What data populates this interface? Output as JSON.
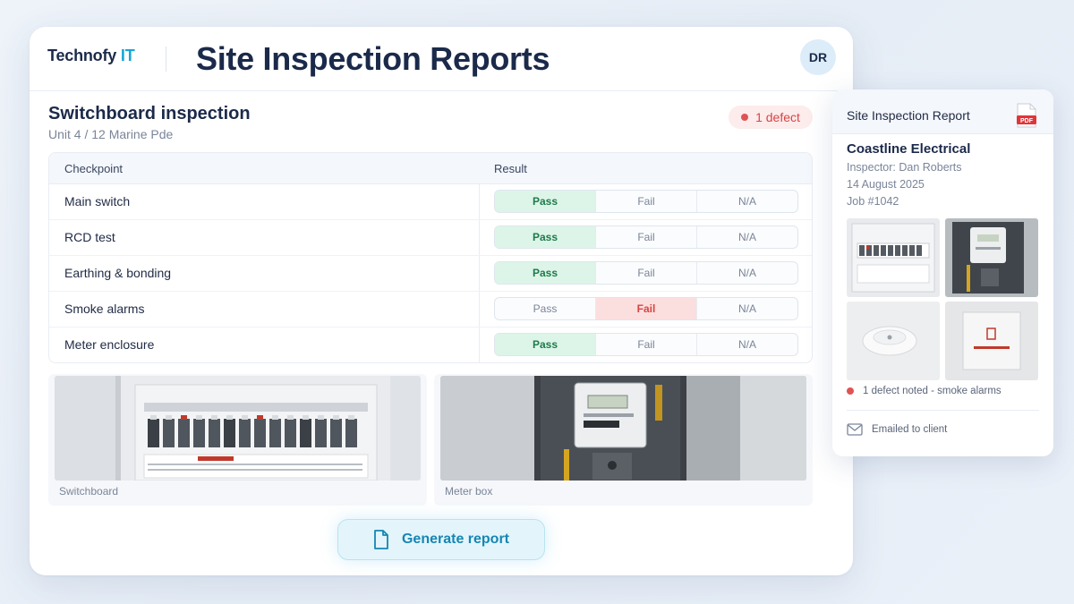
{
  "header": {
    "brand_name": "Technofy",
    "brand_accent": "IT",
    "title": "Site Inspection Reports",
    "avatar_initials": "DR"
  },
  "inspection": {
    "title": "Switchboard inspection",
    "address": "Unit 4 / 12 Marine Pde",
    "defect_badge": "1 defect",
    "columns": [
      "Checkpoint",
      "Result"
    ],
    "options": [
      "Pass",
      "Fail",
      "N/A"
    ],
    "rows": [
      {
        "checkpoint": "Main switch",
        "result": "Pass"
      },
      {
        "checkpoint": "RCD test",
        "result": "Pass"
      },
      {
        "checkpoint": "Earthing & bonding",
        "result": "Pass"
      },
      {
        "checkpoint": "Smoke alarms",
        "result": "Fail"
      },
      {
        "checkpoint": "Meter enclosure",
        "result": "Pass"
      }
    ]
  },
  "photos": [
    {
      "caption": "Switchboard"
    },
    {
      "caption": "Meter box"
    }
  ],
  "actions": {
    "generate_label": "Generate report",
    "icon": "document-icon"
  },
  "report": {
    "title": "Site Inspection Report",
    "pdf_label": "PDF",
    "company": "Coastline Electrical",
    "inspector": "Inspector: Dan Roberts",
    "date": "14 August 2025",
    "job": "Job #1042",
    "defect_note": "1 defect noted - smoke alarms",
    "emailed": "Emailed to client"
  },
  "colors": {
    "accent": "#17a6d9",
    "pass": "#dcf5e8",
    "fail": "#fbdede",
    "defect": "#e05353"
  }
}
